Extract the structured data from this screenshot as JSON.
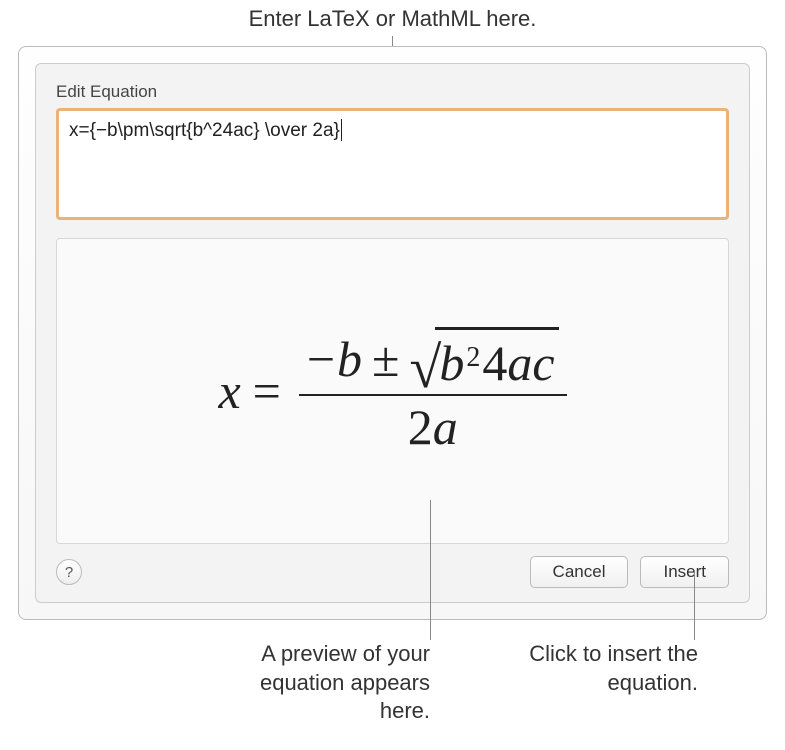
{
  "callouts": {
    "top": "Enter LaTeX or MathML here.",
    "bottom_left": "A preview of your equation appears here.",
    "bottom_right": "Click to insert the equation."
  },
  "dialog": {
    "title": "Edit Equation",
    "input_value": "x={−b\\pm\\sqrt{b^24ac} \\over 2a}",
    "help_label": "?",
    "cancel_label": "Cancel",
    "insert_label": "Insert"
  },
  "equation_preview": {
    "lhs_var": "x",
    "equals": "=",
    "numerator_minus": "−",
    "numerator_b": "b",
    "pm": "±",
    "radical": "√",
    "rad_b": "b",
    "rad_exp": "2",
    "rad_4": "4",
    "rad_a": "a",
    "rad_c": "c",
    "denom_2": "2",
    "denom_a": "a"
  }
}
